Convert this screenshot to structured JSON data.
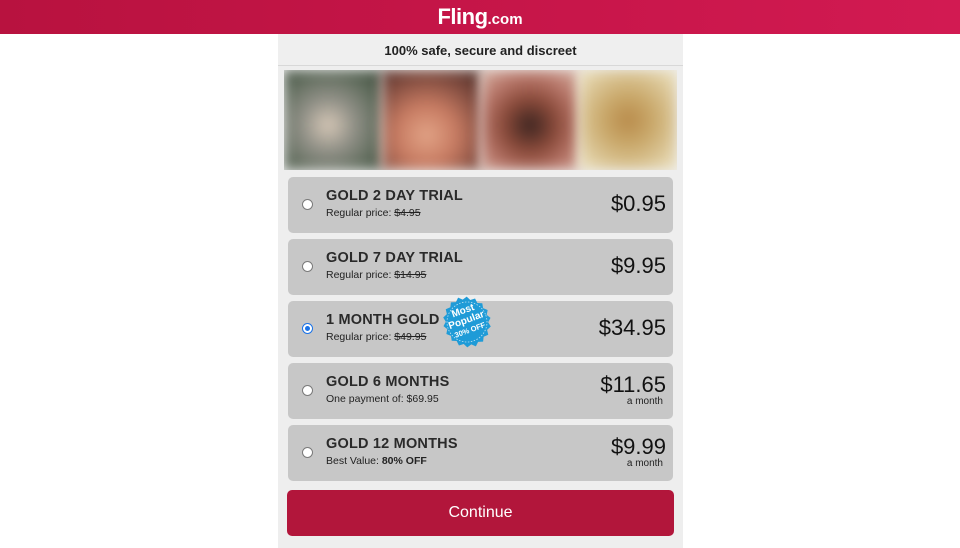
{
  "header": {
    "logo_main": "Fling",
    "logo_tld": ".com"
  },
  "tagline": "100% safe, secure and discreet",
  "plans": [
    {
      "title": "GOLD 2 DAY TRIAL",
      "sub_prefix": "Regular price: ",
      "sub_value": "$4.95",
      "price": "$0.95",
      "unit": "",
      "selected": false
    },
    {
      "title": "GOLD 7 DAY TRIAL",
      "sub_prefix": "Regular price: ",
      "sub_value": "$14.95",
      "price": "$9.95",
      "unit": "",
      "selected": false
    },
    {
      "title": "1 MONTH GOLD",
      "sub_prefix": "Regular price: ",
      "sub_value": "$49.95",
      "price": "$34.95",
      "unit": "",
      "selected": true,
      "badge": {
        "line1": "Most",
        "line2": "Popular",
        "line3": "30% OFF"
      }
    },
    {
      "title": "GOLD 6 MONTHS",
      "sub_prefix": "One payment of: ",
      "sub_value": "$69.95",
      "price": "$11.65",
      "unit": "a month",
      "selected": false
    },
    {
      "title": "GOLD 12 MONTHS",
      "sub_prefix": "Best Value: ",
      "sub_value": "80% OFF",
      "price": "$9.99",
      "unit": "a month",
      "selected": false
    }
  ],
  "continue_label": "Continue",
  "colors": {
    "brand": "#c8164a",
    "button": "#b2163b",
    "badge": "#1f9bd7",
    "plan_bg": "#c7c7c7"
  }
}
